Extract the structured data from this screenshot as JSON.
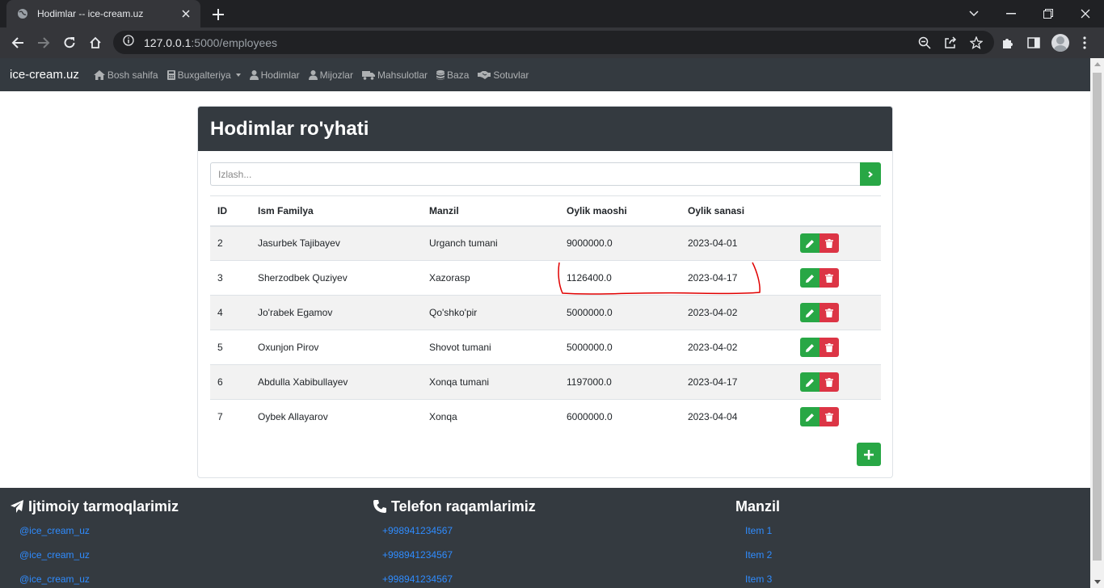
{
  "browser": {
    "tab_title": "Hodimlar -- ice-cream.uz",
    "url_host": "127.0.0.1",
    "url_path": ":5000/employees"
  },
  "nav": {
    "brand": "ice-cream.uz",
    "items": [
      {
        "label": "Bosh sahifa",
        "icon": "home-icon"
      },
      {
        "label": "Buxgalteriya",
        "icon": "calculator-icon"
      },
      {
        "label": "Hodimlar",
        "icon": "user-icon"
      },
      {
        "label": "Mijozlar",
        "icon": "user-icon"
      },
      {
        "label": "Mahsulotlar",
        "icon": "truck-icon"
      },
      {
        "label": "Baza",
        "icon": "database-icon"
      },
      {
        "label": "Sotuvlar",
        "icon": "handshake-icon"
      }
    ]
  },
  "card": {
    "title": "Hodimlar ro'yhati",
    "search_placeholder": "Izlash..."
  },
  "table": {
    "headers": [
      "ID",
      "Ism Familya",
      "Manzil",
      "Oylik maoshi",
      "Oylik sanasi"
    ],
    "rows": [
      [
        "2",
        "Jasurbek Tajibayev",
        "Urganch tumani",
        "9000000.0",
        "2023-04-01"
      ],
      [
        "3",
        "Sherzodbek Quziyev",
        "Xazorasp",
        "1126400.0",
        "2023-04-17"
      ],
      [
        "4",
        "Jo'rabek Egamov",
        "Qo'shko'pir",
        "5000000.0",
        "2023-04-02"
      ],
      [
        "5",
        "Oxunjon Pirov",
        "Shovot tumani",
        "5000000.0",
        "2023-04-02"
      ],
      [
        "6",
        "Abdulla Xabibullayev",
        "Xonqa tumani",
        "1197000.0",
        "2023-04-17"
      ],
      [
        "7",
        "Oybek Allayarov",
        "Xonqa",
        "6000000.0",
        "2023-04-04"
      ]
    ]
  },
  "footer": {
    "social": {
      "title": "Ijtimoiy tarmoqlarimiz",
      "links": [
        "@ice_cream_uz",
        "@ice_cream_uz",
        "@ice_cream_uz"
      ]
    },
    "phones": {
      "title": "Telefon raqamlarimiz",
      "links": [
        "+998941234567",
        "+998941234567",
        "+998941234567"
      ]
    },
    "address": {
      "title": "Manzil",
      "links": [
        "Item 1",
        "Item 2",
        "Item 3"
      ]
    }
  },
  "colors": {
    "dark": "#343a40",
    "success": "#28a745",
    "danger": "#dc3545",
    "link": "#2f8cff",
    "annotation": "#e00000"
  }
}
